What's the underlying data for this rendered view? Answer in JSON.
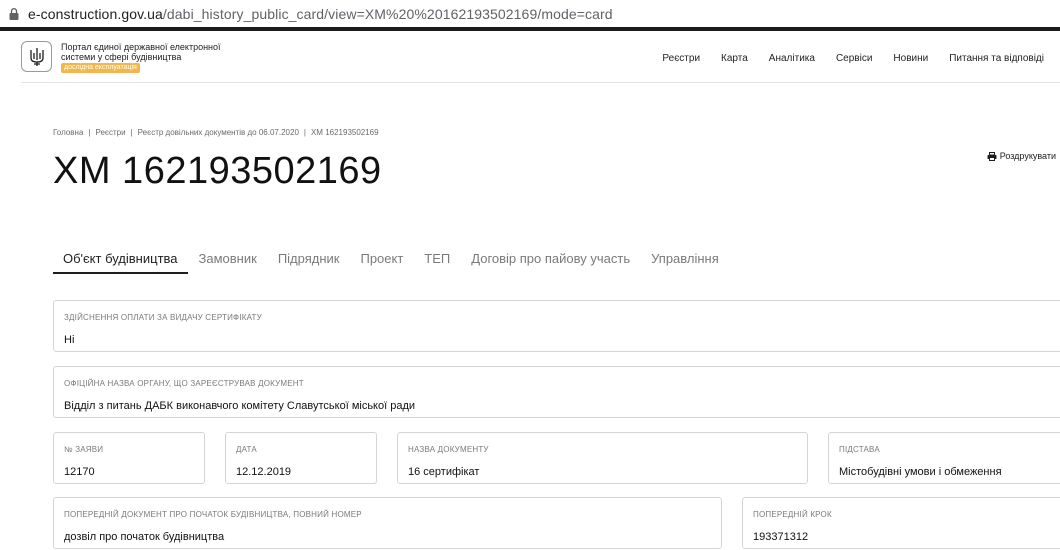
{
  "browser": {
    "url_host": "e-construction.gov.ua",
    "url_path": "/dabi_history_public_card/view=XM%20%20162193502169/mode=card"
  },
  "header": {
    "portal_title": "Портал єдиної державної електронної системи у сфері будівництва",
    "badge": "дослідна експлуатація",
    "nav": [
      "Реєстри",
      "Карта",
      "Аналітика",
      "Сервіси",
      "Новини",
      "Питання та відповіді"
    ]
  },
  "breadcrumb": [
    "Головна",
    "Реєстри",
    "Реєстр довільних документів до 06.07.2020",
    "ХМ 162193502169"
  ],
  "page": {
    "title": "ХМ 162193502169",
    "print_label": "Роздрукувати"
  },
  "tabs": [
    "Об'єкт будівництва",
    "Замовник",
    "Підрядник",
    "Проект",
    "ТЕП",
    "Договір про пайову участь",
    "Управління"
  ],
  "active_tab": 0,
  "fields": {
    "payment": {
      "label": "Здійснення оплати за видачу сертифікату",
      "value": "Ні"
    },
    "authority": {
      "label": "Офіційна назва органу, що зареєстрував документ",
      "value": "Відділ з питань ДАБК виконавчого комітету Славутської міської ради"
    },
    "application_no": {
      "label": "№ заяви",
      "value": "12170"
    },
    "date": {
      "label": "Дата",
      "value": "12.12.2019"
    },
    "doc_name": {
      "label": "Назва документу",
      "value": "16 сертифікат"
    },
    "basis": {
      "label": "Підстава",
      "value": "Містобудівні умови і обмеження"
    },
    "prev_doc": {
      "label": "Попередній документ про початок будівництва, повний номер",
      "value": "дозвіл про початок будівництва"
    },
    "prev_step": {
      "label": "Попередній крок",
      "value": "193371312"
    }
  }
}
